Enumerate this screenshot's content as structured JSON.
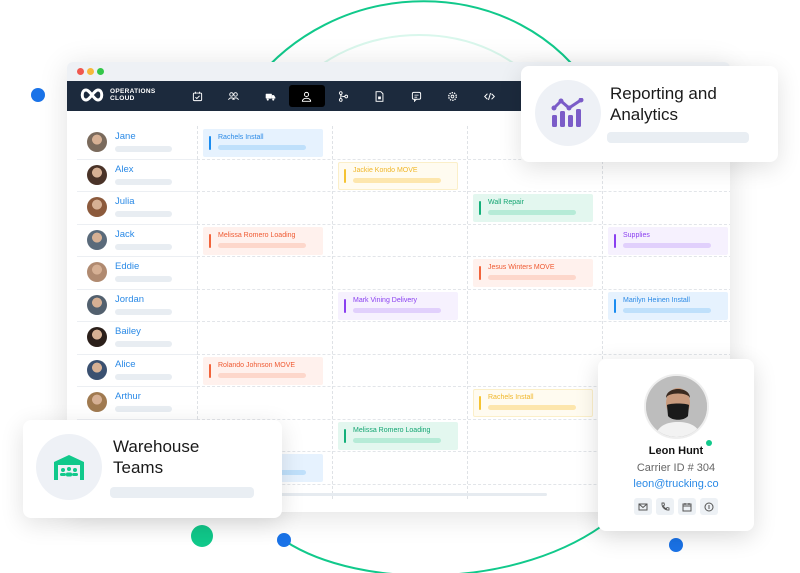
{
  "app": {
    "brand_line1": "OPERATIONS",
    "brand_line2": "CLOUD"
  },
  "colors": {
    "navbar": "#1c2a3d",
    "accent_green": "#11c98b",
    "accent_blue": "#1a73e8",
    "analytics_purple": "#7b5cc8"
  },
  "nav": {
    "icons": [
      {
        "name": "calendar-check-icon",
        "active": false
      },
      {
        "name": "users-icon",
        "active": false
      },
      {
        "name": "truck-icon",
        "active": false
      },
      {
        "name": "user-icon",
        "active": true
      },
      {
        "name": "workflow-icon",
        "active": false
      },
      {
        "name": "document-icon",
        "active": false
      },
      {
        "name": "message-icon",
        "active": false
      },
      {
        "name": "settings-icon",
        "active": false
      },
      {
        "name": "code-icon",
        "active": false
      }
    ]
  },
  "people": [
    {
      "name": "Jane"
    },
    {
      "name": "Alex"
    },
    {
      "name": "Julia"
    },
    {
      "name": "Jack"
    },
    {
      "name": "Eddie"
    },
    {
      "name": "Jordan"
    },
    {
      "name": "Bailey"
    },
    {
      "name": "Alice"
    },
    {
      "name": "Arthur"
    }
  ],
  "events": [
    {
      "label": "Rachels Install",
      "row": 0,
      "col": 0,
      "color": "blue"
    },
    {
      "label": "Jackie Kondo MOVE",
      "row": 1,
      "col": 1,
      "color": "yellow"
    },
    {
      "label": "Wall Repair",
      "row": 2,
      "col": 2,
      "color": "green"
    },
    {
      "label": "Melissa Romero Loading",
      "row": 3,
      "col": 0,
      "color": "orange"
    },
    {
      "label": "Supplies",
      "row": 3,
      "col": 3,
      "color": "purple"
    },
    {
      "label": "Jesus Winters MOVE",
      "row": 4,
      "col": 2,
      "color": "orange"
    },
    {
      "label": "Mark Vining Delivery",
      "row": 5,
      "col": 1,
      "color": "purple"
    },
    {
      "label": "Marilyn Heinen Install",
      "row": 5,
      "col": 3,
      "color": "blue"
    },
    {
      "label": "Rolando Johnson MOVE",
      "row": 7,
      "col": 0,
      "color": "orange"
    },
    {
      "label": "Rachels Install",
      "row": 8,
      "col": 2,
      "color": "yellow"
    },
    {
      "label": "Melissa Romero Loading",
      "row": 9,
      "col": 1,
      "color": "green"
    },
    {
      "label": "",
      "row": 10,
      "col": 0,
      "color": "blue"
    }
  ],
  "reporting_card": {
    "title_line1": "Reporting and",
    "title_line2": "Analytics"
  },
  "warehouse_card": {
    "title_line1": "Warehouse",
    "title_line2": "Teams"
  },
  "profile": {
    "name": "Leon Hunt",
    "carrier_id": "Carrier ID # 304",
    "email": "leon@trucking.co",
    "status": "online",
    "actions": [
      "mail-icon",
      "phone-icon",
      "calendar-icon",
      "info-icon"
    ]
  }
}
